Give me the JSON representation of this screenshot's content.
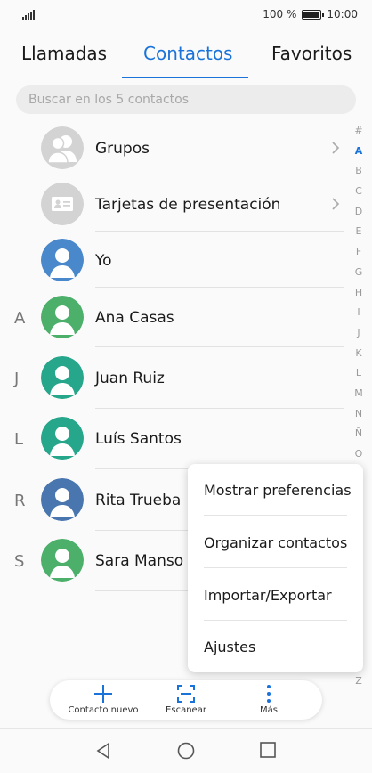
{
  "status": {
    "battery": "100 %",
    "time": "10:00"
  },
  "tabs": [
    {
      "label": "Llamadas"
    },
    {
      "label": "Contactos"
    },
    {
      "label": "Favoritos"
    }
  ],
  "search": {
    "placeholder": "Buscar en los 5 contactos"
  },
  "special_rows": [
    {
      "label": "Grupos"
    },
    {
      "label": "Tarjetas de presentación"
    },
    {
      "label": "Yo"
    }
  ],
  "contacts": [
    {
      "letter": "A",
      "name": "Ana Casas",
      "color": "#4caf6a"
    },
    {
      "letter": "J",
      "name": "Juan Ruiz",
      "color": "#26a68a"
    },
    {
      "letter": "L",
      "name": "Luís Santos",
      "color": "#26a68a"
    },
    {
      "letter": "R",
      "name": "Rita Trueba",
      "color": "#4a76b0"
    },
    {
      "letter": "S",
      "name": "Sara Manso",
      "color": "#4caf6a"
    }
  ],
  "alphabet": [
    "#",
    "A",
    "B",
    "C",
    "D",
    "E",
    "F",
    "G",
    "H",
    "I",
    "J",
    "K",
    "L",
    "M",
    "N",
    "Ñ",
    "O",
    "Z"
  ],
  "alphabet_active": "A",
  "menu": [
    {
      "label": "Mostrar preferencias"
    },
    {
      "label": "Organizar contactos"
    },
    {
      "label": "Importar/Exportar"
    },
    {
      "label": "Ajustes"
    }
  ],
  "bottom_actions": [
    {
      "label": "Contacto nuevo",
      "icon": "plus-icon"
    },
    {
      "label": "Escanear",
      "icon": "scan-icon"
    },
    {
      "label": "Más",
      "icon": "more-vertical-icon"
    }
  ],
  "colors": {
    "accent": "#1a73d9",
    "me_avatar": "#4a88cc"
  }
}
